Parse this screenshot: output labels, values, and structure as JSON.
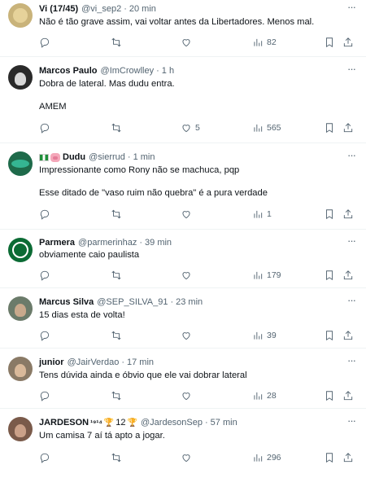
{
  "tweets": [
    {
      "name": "Vi (17/45)",
      "handle": "@vi_sep2",
      "time": "20 min",
      "text": "Não é tão grave assim, vai voltar antes da Libertadores. Menos mal.",
      "replies": "",
      "retweets": "",
      "likes": "",
      "views": "82",
      "avatar_color": "#c9b37a"
    },
    {
      "name": "Marcos Paulo",
      "handle": "@ImCrowlley",
      "time": "1 h",
      "text": "Dobra de lateral. Mas dudu entra.\n\nAMEM",
      "replies": "",
      "retweets": "",
      "likes": "5",
      "views": "565",
      "avatar_color": "#2a2a2a"
    },
    {
      "name": "Dudu",
      "handle": "@sierrud",
      "time": "1 min",
      "text": "Impressionante como Rony não se machuca, pqp\n\nEsse ditado de \"vaso ruim não quebra\" é a pura verdade",
      "replies": "",
      "retweets": "",
      "likes": "",
      "views": "1",
      "avatar_color": "#1e6a4a"
    },
    {
      "name": "Parmera",
      "handle": "@parmerinhaz",
      "time": "39 min",
      "text": "obviamente caio paulista",
      "replies": "",
      "retweets": "",
      "likes": "",
      "views": "179",
      "avatar_color": "#0b6b34"
    },
    {
      "name": "Marcus Silva",
      "handle": "@SEP_SILVA_91",
      "time": "23 min",
      "text": "15 dias esta de volta!",
      "replies": "",
      "retweets": "",
      "likes": "",
      "views": "39",
      "avatar_color": "#6b7b6a"
    },
    {
      "name": "junior",
      "handle": "@JairVerdao",
      "time": "17 min",
      "text": "Tens dúvida ainda e óbvio que ele vai dobrar lateral",
      "replies": "",
      "retweets": "",
      "likes": "",
      "views": "28",
      "avatar_color": "#8a7a66"
    },
    {
      "name": "JARDESON",
      "name_suffix": "¹⁹¹⁴",
      "name_suffix2": "12",
      "handle": "@JardesonSep",
      "time": "57 min",
      "text": "Um camisa 7 aí tá apto a jogar.",
      "replies": "",
      "retweets": "",
      "likes": "",
      "views": "296",
      "avatar_color": "#7a5a4a"
    }
  ],
  "icons": {
    "reply": "reply-icon",
    "retweet": "retweet-icon",
    "like": "heart-icon",
    "views": "views-icon",
    "bookmark": "bookmark-icon",
    "share": "share-icon",
    "more": "more-icon"
  },
  "dot": "·",
  "more_glyph": "···"
}
